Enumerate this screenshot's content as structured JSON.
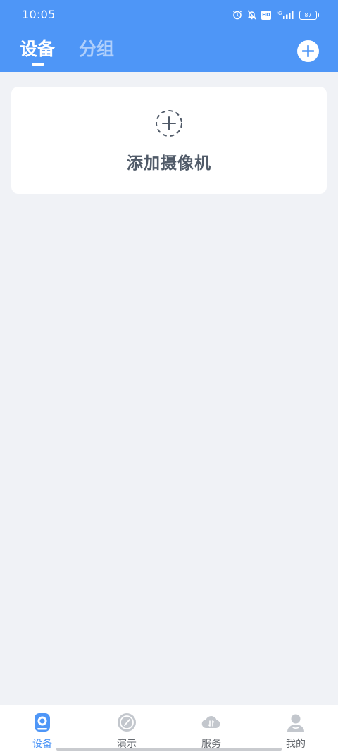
{
  "status_bar": {
    "time": "10:05",
    "hd": "HD",
    "network": "4G",
    "battery": "87",
    "icons": [
      "alarm-icon",
      "mute-bell-icon",
      "hd-icon",
      "signal-icon",
      "battery-icon"
    ]
  },
  "header": {
    "tabs": [
      {
        "label": "设备",
        "active": true
      },
      {
        "label": "分组",
        "active": false
      }
    ],
    "add_icon": "plus-circle-icon"
  },
  "main": {
    "add_camera_label": "添加摄像机",
    "add_camera_icon": "dashed-plus-icon"
  },
  "bottom_nav": {
    "items": [
      {
        "label": "设备",
        "icon": "camera-icon",
        "active": true
      },
      {
        "label": "演示",
        "icon": "demo-icon",
        "active": false
      },
      {
        "label": "服务",
        "icon": "cloud-icon",
        "active": false
      },
      {
        "label": "我的",
        "icon": "user-icon",
        "active": false
      }
    ]
  },
  "colors": {
    "accent": "#4e96f7",
    "background": "#f0f2f6",
    "card": "#ffffff",
    "inactive_icon": "#c3c7cd"
  }
}
